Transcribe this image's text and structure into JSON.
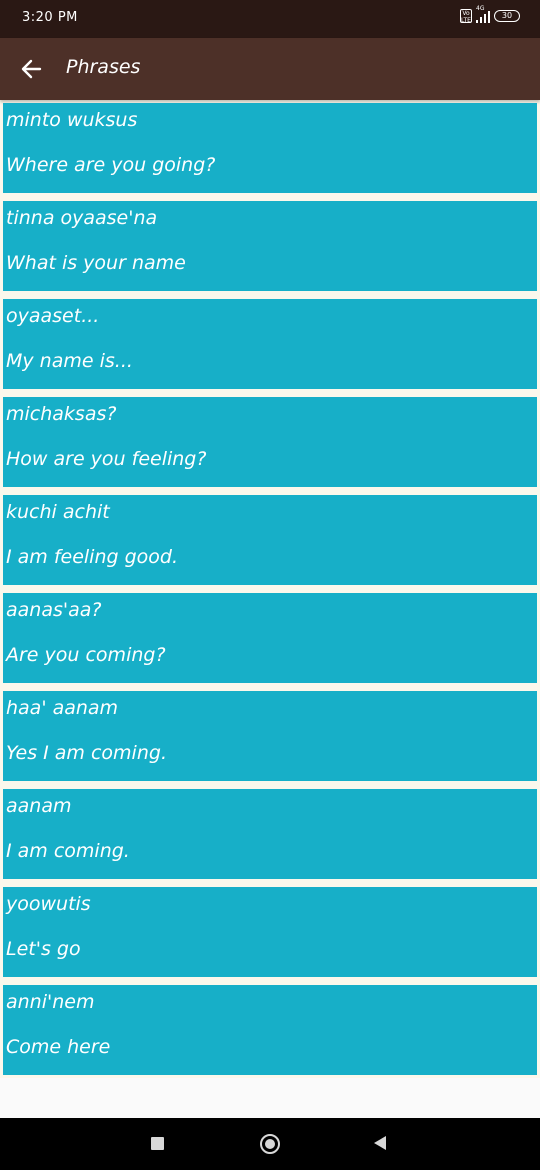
{
  "status_bar": {
    "time": "3:20 PM",
    "network": "4G",
    "battery": "30"
  },
  "app_bar": {
    "title": "Phrases",
    "back_icon": "arrow-left-icon"
  },
  "phrases": [
    {
      "native": "minto wuksus",
      "english": "Where are you going?"
    },
    {
      "native": "tinna oyaase'na",
      "english": "What is your name"
    },
    {
      "native": "oyaaset...",
      "english": "My name is..."
    },
    {
      "native": "michaksas?",
      "english": "How are you feeling?"
    },
    {
      "native": "kuchi achit",
      "english": "I am feeling good."
    },
    {
      "native": "aanas'aa?",
      "english": "Are you coming?"
    },
    {
      "native": "haa' aanam",
      "english": "Yes I am coming."
    },
    {
      "native": "aanam",
      "english": "I am coming."
    },
    {
      "native": "yoowutis",
      "english": "Let's go"
    },
    {
      "native": "anni'nem",
      "english": "Come here"
    }
  ],
  "nav_bar": {
    "recent_icon": "square-icon",
    "home_icon": "circle-icon",
    "back_icon": "triangle-back-icon"
  },
  "colors": {
    "status_bar": "#2a1814",
    "app_bar": "#4d3028",
    "card": "#17afc8",
    "background": "#fbf8ec"
  }
}
